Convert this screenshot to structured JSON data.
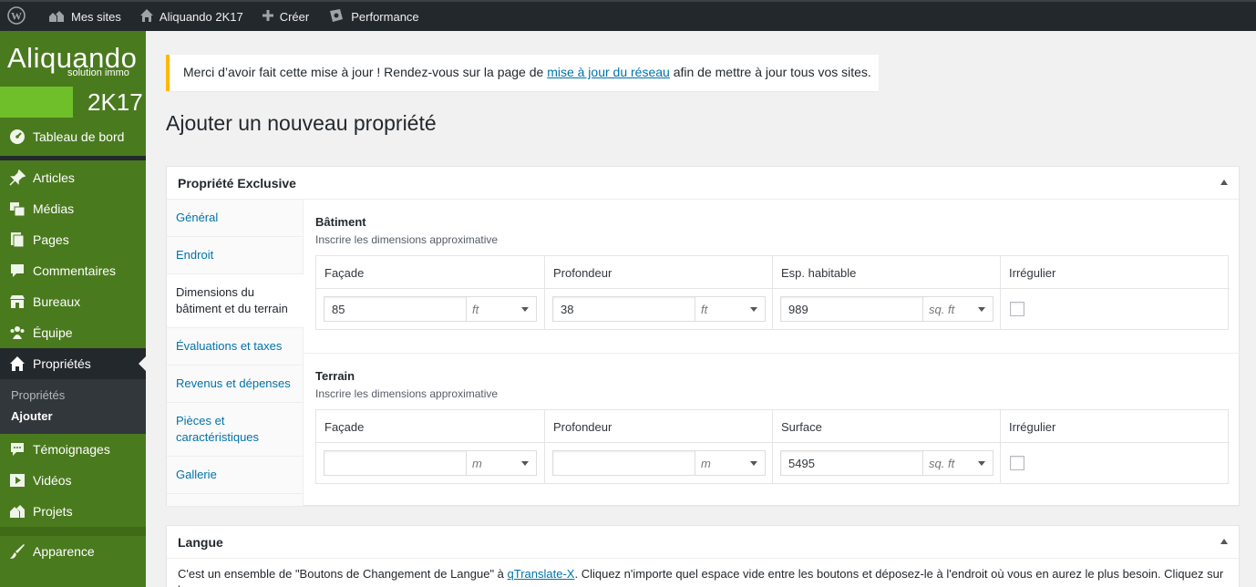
{
  "adminbar": {
    "items": [
      {
        "label": "",
        "icon": "wordpress-icon"
      },
      {
        "label": "Mes sites",
        "icon": "sites-icon"
      },
      {
        "label": "Aliquando 2K17",
        "icon": "home-icon"
      },
      {
        "label": "Créer",
        "icon": "plus-icon"
      },
      {
        "label": "Performance",
        "icon": "performance-icon"
      }
    ]
  },
  "logo": {
    "name": "Aliquando",
    "tagline": "solution immo",
    "year": "2K17"
  },
  "sidebar": {
    "items": [
      {
        "label": "Tableau de bord",
        "icon": "dashboard-icon"
      },
      {
        "label": "Articles",
        "icon": "pin-icon"
      },
      {
        "label": "Médias",
        "icon": "media-icon"
      },
      {
        "label": "Pages",
        "icon": "pages-icon"
      },
      {
        "label": "Commentaires",
        "icon": "comments-icon"
      },
      {
        "label": "Bureaux",
        "icon": "store-icon"
      },
      {
        "label": "Équipe",
        "icon": "groups-icon"
      },
      {
        "label": "Propriétés",
        "icon": "home-icon"
      },
      {
        "label": "Témoignages",
        "icon": "testimonial-icon"
      },
      {
        "label": "Vidéos",
        "icon": "video-icon"
      },
      {
        "label": "Projets",
        "icon": "projects-icon"
      },
      {
        "label": "Apparence",
        "icon": "brush-icon"
      }
    ],
    "submenu": [
      "Propriétés",
      "Ajouter"
    ]
  },
  "notice": {
    "before": "Merci d’avoir fait cette mise à jour ! Rendez-vous sur la page de ",
    "link": "mise à jour du réseau",
    "after": " afin de mettre à jour tous vos sites."
  },
  "page_title": "Ajouter un nouveau propriété",
  "metabox": {
    "title": "Propriété Exclusive",
    "tabs": [
      "Général",
      "Endroit",
      "Dimensions du bâtiment et du terrain",
      "Évaluations et taxes",
      "Revenus et dépenses",
      "Pièces et caractéristiques",
      "Gallerie"
    ],
    "batiment": {
      "title": "Bâtiment",
      "desc": "Inscrire les dimensions approximative",
      "headers": [
        "Façade",
        "Profondeur",
        "Esp. habitable",
        "Irrégulier"
      ],
      "fields": [
        {
          "value": "85",
          "unit": "ft"
        },
        {
          "value": "38",
          "unit": "ft"
        },
        {
          "value": "989",
          "unit": "sq. ft"
        }
      ]
    },
    "terrain": {
      "title": "Terrain",
      "desc": "Inscrire les dimensions approximative",
      "headers": [
        "Façade",
        "Profondeur",
        "Surface",
        "Irrégulier"
      ],
      "fields": [
        {
          "value": "",
          "unit": "m"
        },
        {
          "value": "",
          "unit": "m"
        },
        {
          "value": "5495",
          "unit": "sq. ft"
        }
      ]
    }
  },
  "langue": {
    "title": "Langue",
    "text_before": "C'est un ensemble de \"Boutons de Changement de Langue\" à ",
    "link": "qTranslate-X",
    "text_after": ". Cliquez n'importe quel espace vide entre les boutons et déposez-le à l'endroit où vous en aurez le plus besoin. Cliquez sur la"
  },
  "colors": {
    "sidebar": "#4a7a1e",
    "accent": "#6fbf2b",
    "link": "#0073aa",
    "notice": "#ffb900"
  }
}
